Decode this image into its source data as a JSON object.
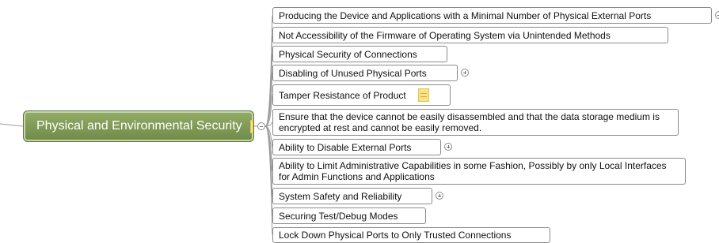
{
  "central_topic": {
    "label": "Physical and Environmental Security",
    "icon": "note-icon"
  },
  "subtopics": [
    {
      "label": "Producing the Device and Applications with a Minimal Number of Physical External Ports",
      "collapsed": true
    },
    {
      "label": "Not Accessibility of the Firmware of Operating System via Unintended Methods"
    },
    {
      "label": "Physical Security of Connections"
    },
    {
      "label": "Disabling of Unused Physical Ports",
      "collapsed": true
    },
    {
      "label": "Tamper Resistance of Product",
      "icon": "note-icon"
    },
    {
      "label": "Ensure that the device cannot be easily disassembled and that the data storage medium is encrypted at rest and cannot be easily removed."
    },
    {
      "label": "Ability to Disable External Ports",
      "collapsed": true
    },
    {
      "label": "Ability to Limit Administrative Capabilities in some Fashion, Possibly by only Local Interfaces for Admin Functions and Applications"
    },
    {
      "label": "System Safety and Reliability",
      "collapsed": true
    },
    {
      "label": "Securing Test/Debug Modes"
    },
    {
      "label": "Lock Down Physical Ports to Only Trusted Connections"
    }
  ],
  "colors": {
    "central_fill": "#7f9a55",
    "central_text": "#ffffff",
    "topic_border": "#8a8a8a",
    "connector": "#9a9a9a",
    "note_icon": "#f7e48a"
  }
}
